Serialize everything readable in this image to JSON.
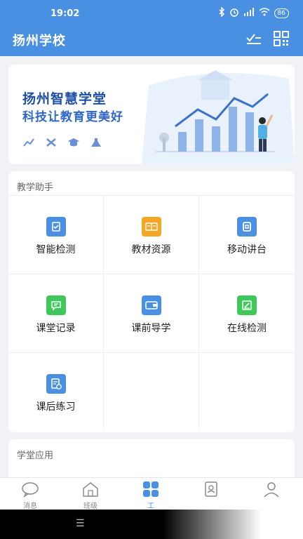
{
  "status": {
    "time": "19:02",
    "battery": "86"
  },
  "header": {
    "title": "扬州学校"
  },
  "banner": {
    "title": "扬州智慧学堂",
    "subtitle": "科技让教育更美好"
  },
  "teaching": {
    "title": "教学助手",
    "items": [
      {
        "label": "智能检测",
        "icon": "clipboard-icon",
        "color": "#4a90e2"
      },
      {
        "label": "教材资源",
        "icon": "book-icon",
        "color": "#f5a623"
      },
      {
        "label": "移动讲台",
        "icon": "podium-icon",
        "color": "#4a90e2"
      },
      {
        "label": "课堂记录",
        "icon": "chat-icon",
        "color": "#3ec85a"
      },
      {
        "label": "课前导学",
        "icon": "wallet-icon",
        "color": "#4a90e2"
      },
      {
        "label": "在线检测",
        "icon": "edit-icon",
        "color": "#3ec85a"
      },
      {
        "label": "课后练习",
        "icon": "document-clock-icon",
        "color": "#4a90e2"
      }
    ]
  },
  "apps": {
    "title": "学堂应用"
  },
  "tabs": [
    {
      "label": "消息",
      "icon": "message-icon"
    },
    {
      "label": "班级",
      "icon": "home-icon"
    },
    {
      "label": "工",
      "icon": "grid-icon",
      "active": true
    },
    {
      "label": "",
      "icon": "contacts-icon"
    },
    {
      "label": "",
      "icon": "profile-icon"
    }
  ],
  "colors": {
    "primary": "#4a90e2",
    "background": "#f1f2f5"
  }
}
